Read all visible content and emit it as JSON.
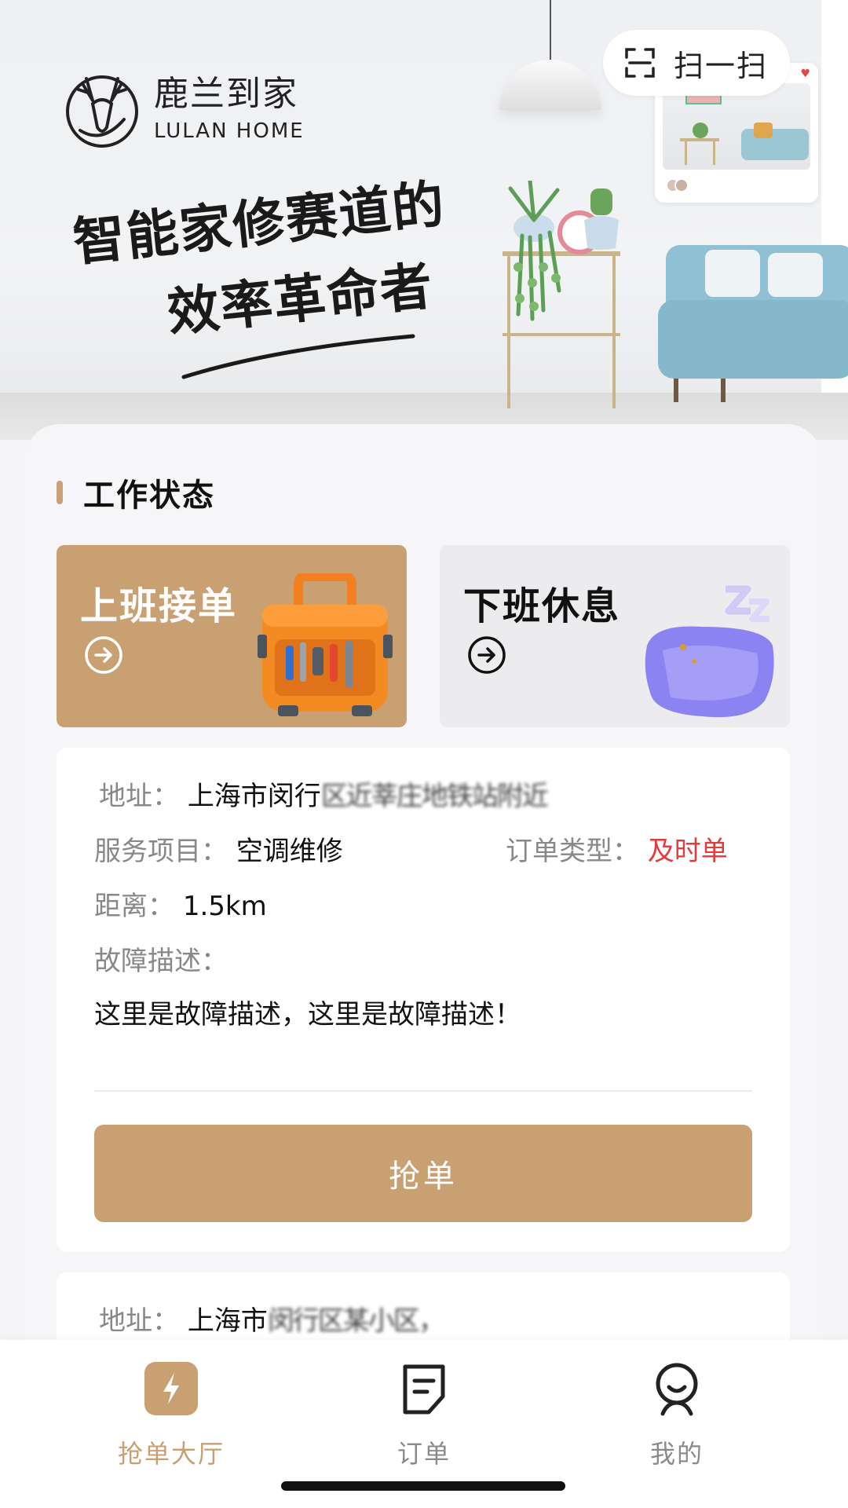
{
  "hero": {
    "brand_cn": "鹿兰到家",
    "brand_en": "LULAN HOME",
    "slogan_line1": "智能家修赛道的",
    "slogan_line2": "效率革命者",
    "scan_label": "扫一扫"
  },
  "work_status": {
    "title": "工作状态",
    "on_duty": "上班接单",
    "off_duty": "下班休息"
  },
  "orders": [
    {
      "address_label": "地址：",
      "address_value": "上海市闵行",
      "address_blurred": "区近莘庄地铁站附近",
      "service_label": "服务项目：",
      "service_value": "空调维修",
      "type_label": "订单类型：",
      "type_value": "及时单",
      "distance_label": "距离：",
      "distance_value": "1.5km",
      "fault_label": "故障描述：",
      "fault_value": "这里是故障描述，这里是故障描述！",
      "grab_label": "抢单"
    },
    {
      "address_label": "地址：",
      "address_value": "上海市",
      "address_blurred": "闵行区某小区，"
    }
  ],
  "tabs": [
    {
      "label": "抢单大厅",
      "icon": "lightning-icon",
      "active": true
    },
    {
      "label": "订单",
      "icon": "order-doc-icon",
      "active": false
    },
    {
      "label": "我的",
      "icon": "person-icon",
      "active": false
    }
  ],
  "colors": {
    "accent": "#c9a072",
    "urgent": "#e53a3a",
    "off_card_bg": "#ececee"
  }
}
